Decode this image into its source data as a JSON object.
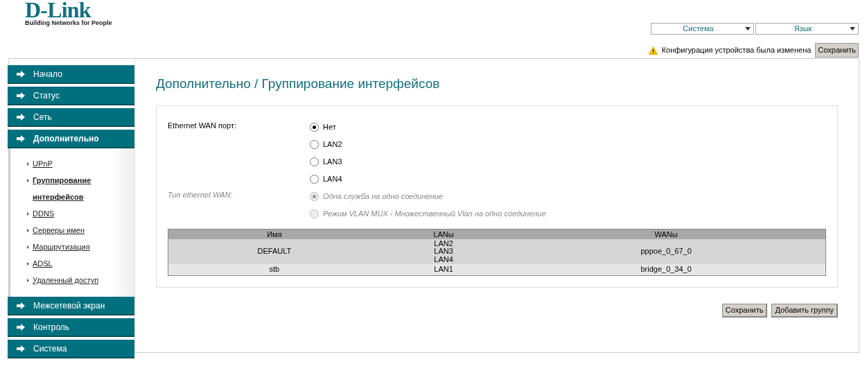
{
  "logo": {
    "brand": "D-Link",
    "tagline": "Building Networks for People"
  },
  "top_menus": [
    {
      "label": "Система"
    },
    {
      "label": "Язык"
    }
  ],
  "notice": {
    "text": "Конфигурация устройства была изменена",
    "button": "Сохранить"
  },
  "nav_top": [
    {
      "label": "Начало",
      "selected": false
    },
    {
      "label": "Статус",
      "selected": false
    },
    {
      "label": "Сеть",
      "selected": false
    },
    {
      "label": "Дополнительно",
      "selected": true
    }
  ],
  "subnav": [
    {
      "label": "UPnP",
      "selected": false
    },
    {
      "label": "Группирование интерфейсов",
      "selected": true
    },
    {
      "label": "DDNS",
      "selected": false
    },
    {
      "label": "Серверы имен",
      "selected": false
    },
    {
      "label": "Маршрутизация",
      "selected": false
    },
    {
      "label": "ADSL",
      "selected": false
    },
    {
      "label": "Удаленный доступ",
      "selected": false
    }
  ],
  "nav_bottom": [
    {
      "label": "Межсетевой экран",
      "selected": false
    },
    {
      "label": "Контроль",
      "selected": false
    },
    {
      "label": "Система",
      "selected": false
    }
  ],
  "page_title": "Дополнительно / Группирование интерфейсов",
  "wan_port": {
    "label": "Ethernet WAN порт:",
    "disabled": false,
    "options": [
      {
        "label": "Нет",
        "selected": true
      },
      {
        "label": "LAN2",
        "selected": false
      },
      {
        "label": "LAN3",
        "selected": false
      },
      {
        "label": "LAN4",
        "selected": false
      }
    ]
  },
  "wan_type": {
    "label": "Тип ethernet WAN:",
    "disabled": true,
    "options": [
      {
        "label": "Одна служба на одно соединение",
        "selected": true
      },
      {
        "label": "Режим VLAN MUX - Множественный Vlan на одно соединение",
        "selected": false
      }
    ]
  },
  "table": {
    "columns": [
      "Имя",
      "LANы",
      "WANы"
    ],
    "rows": [
      {
        "name": "DEFAULT",
        "lans": [
          "LAN2",
          "LAN3",
          "LAN4"
        ],
        "wans": "pppoe_0_67_0"
      },
      {
        "name": "stb",
        "lans": [
          "LAN1"
        ],
        "wans": "bridge_0_34_0"
      }
    ]
  },
  "buttons": [
    "Сохранить",
    "Добавить группу"
  ]
}
